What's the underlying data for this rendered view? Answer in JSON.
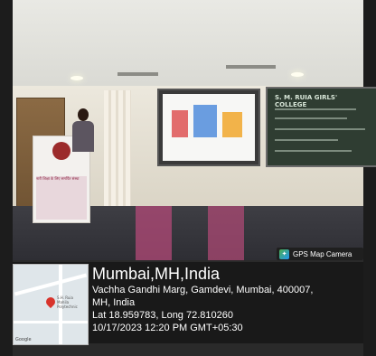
{
  "photo": {
    "projector_screen": "presentation slide",
    "blackboard": {
      "heading": "S. M. RUIA GIRLS' COLLEGE"
    },
    "podium_banner": "नारी शिक्षा के लिए समर्पित संस्था"
  },
  "gps_badge": {
    "icon": "map-camera-icon",
    "label": "GPS Map Camera"
  },
  "map": {
    "pin_label": "S.H. Ruia Mahila Polytechnic",
    "google": "Google"
  },
  "location": {
    "title": "Mumbai,MH,India",
    "address": "Vachha Gandhi Marg, Gamdevi, Mumbai, 400007,",
    "region": "MH, India",
    "coords": "Lat 18.959783, Long 72.810260",
    "datetime": "10/17/2023 12:20 PM GMT+05:30"
  }
}
